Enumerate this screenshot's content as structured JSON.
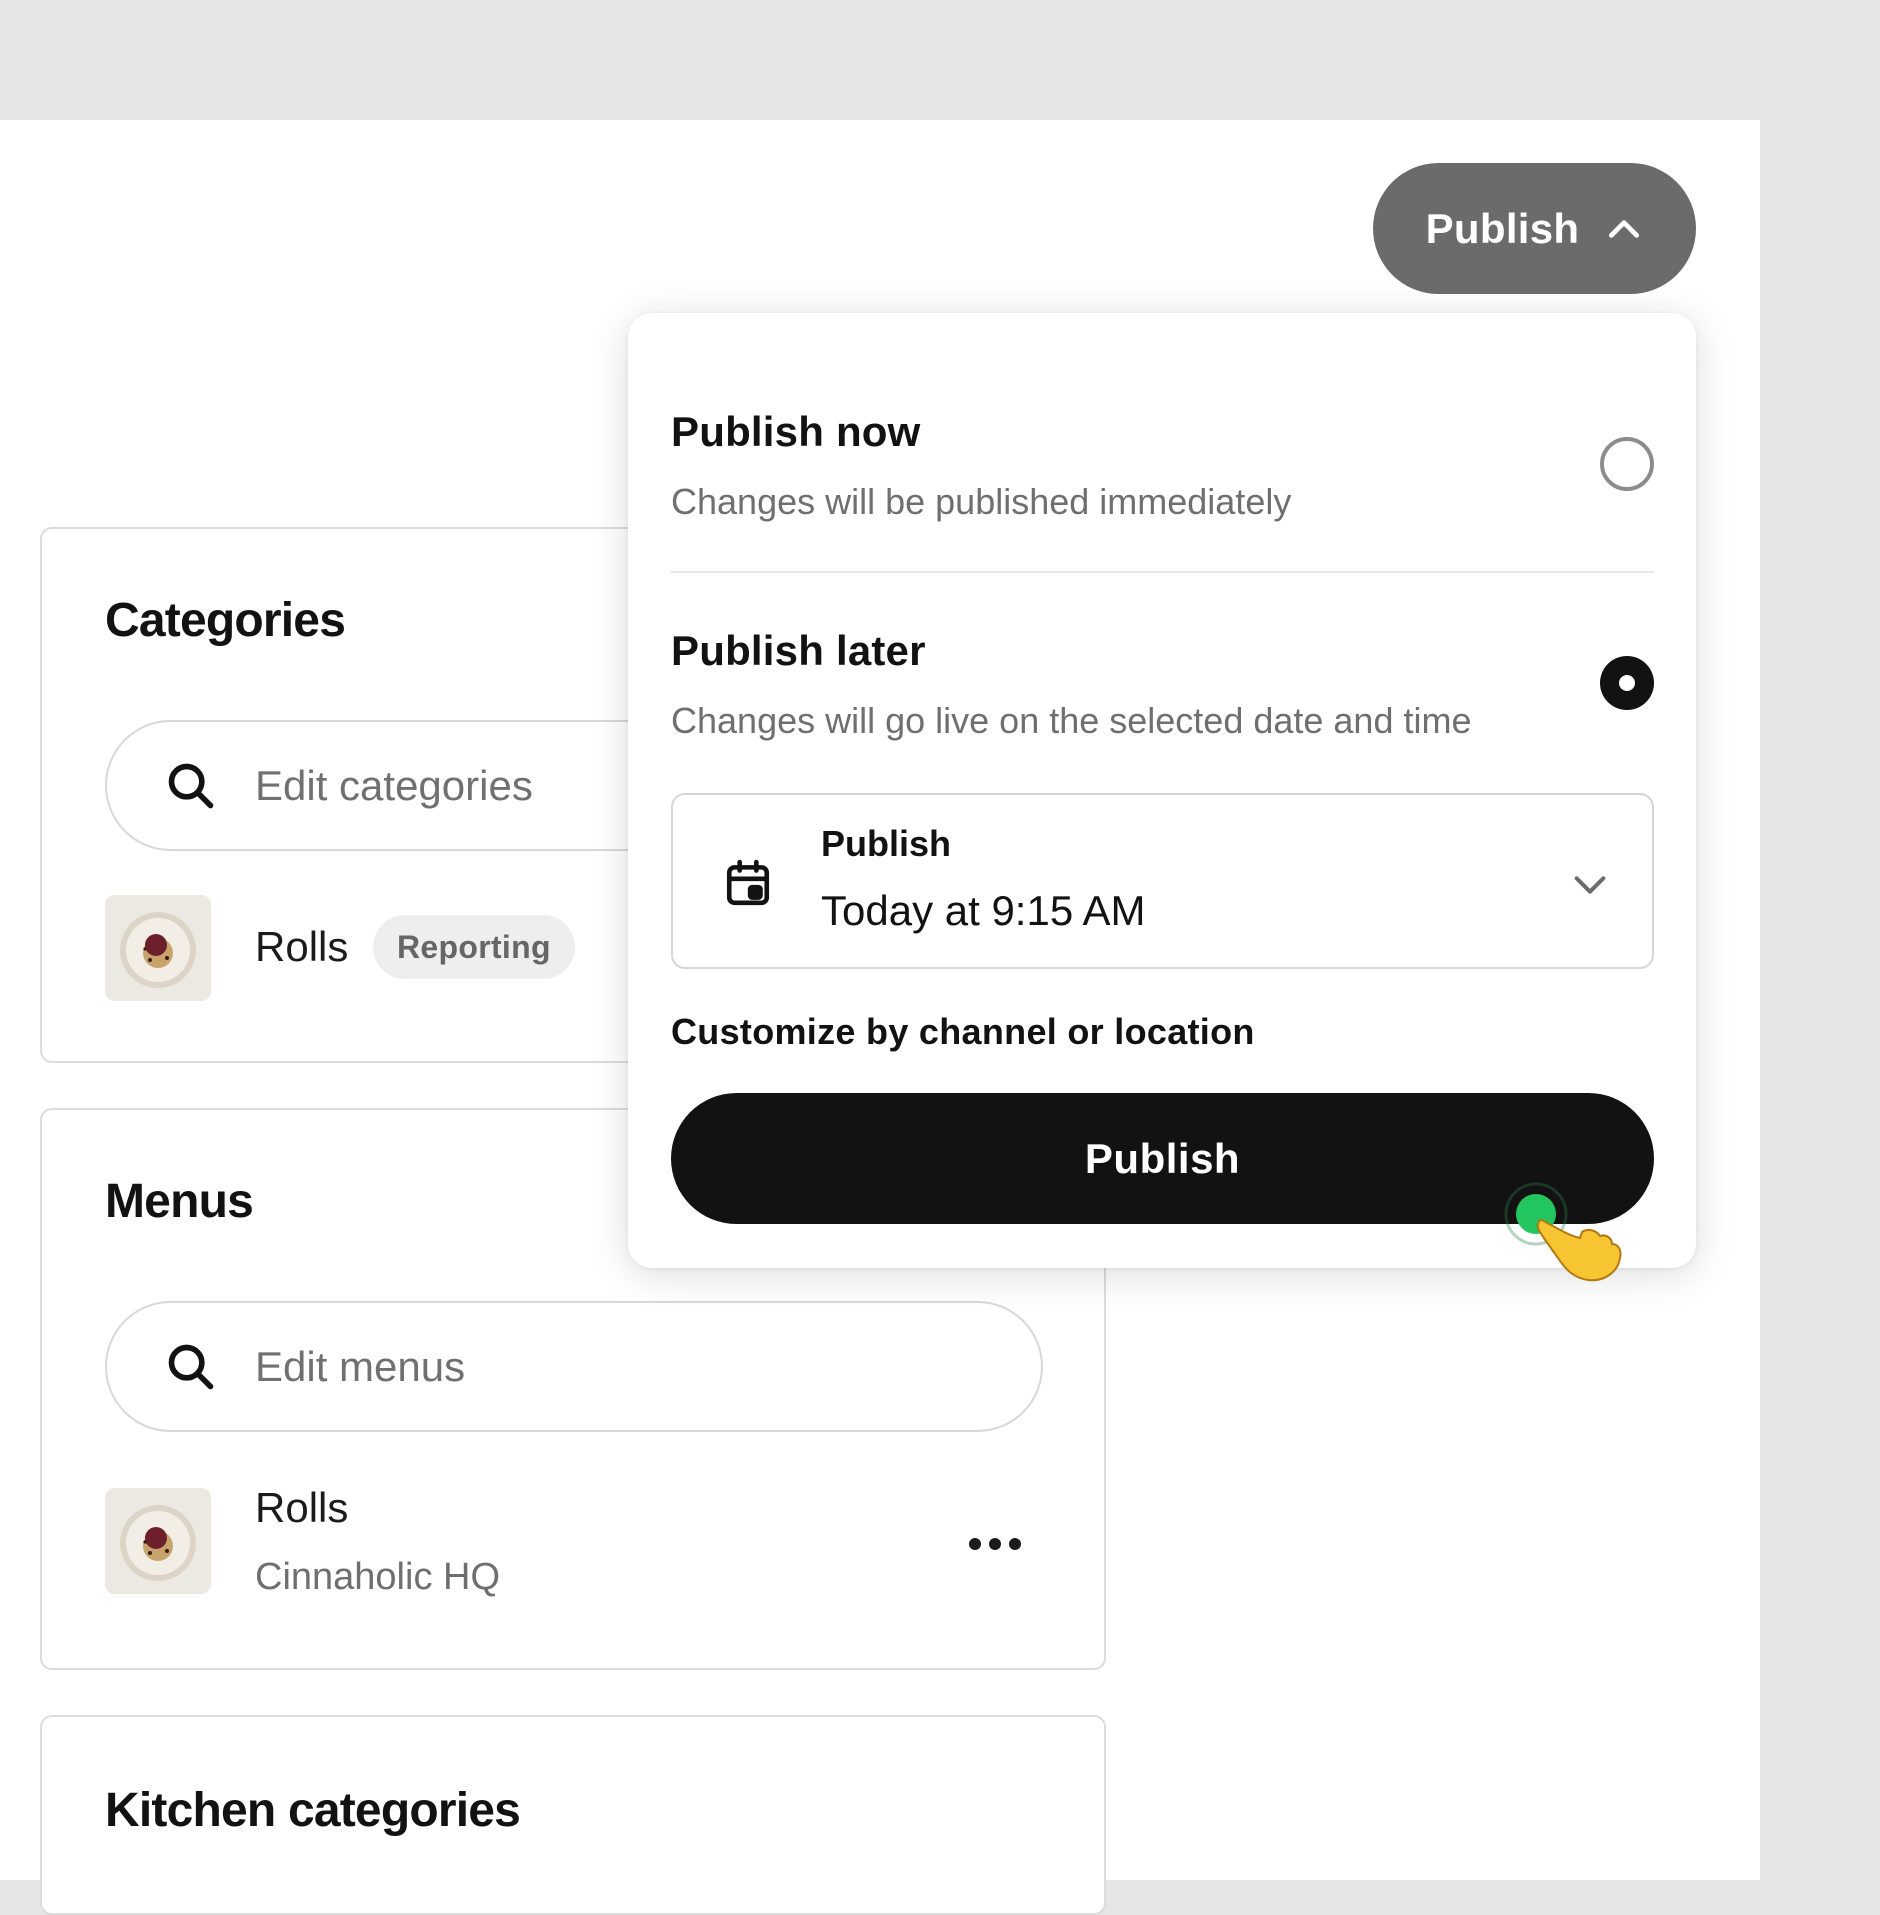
{
  "header": {
    "publish_label": "Publish",
    "publish_icon": "chevron-up-icon"
  },
  "categories": {
    "title": "Categories",
    "search_placeholder": "Edit categories",
    "items": [
      {
        "name": "Rolls",
        "badge": "Reporting"
      }
    ]
  },
  "menus": {
    "title": "Menus",
    "search_placeholder": "Edit menus",
    "items": [
      {
        "name": "Rolls",
        "location": "Cinnaholic HQ"
      }
    ]
  },
  "kitchen_categories": {
    "title": "Kitchen categories"
  },
  "publish_dropdown": {
    "options": [
      {
        "title": "Publish now",
        "description": "Changes will be published immediately",
        "selected": false
      },
      {
        "title": "Publish later",
        "description": "Changes will go live on the selected date and time",
        "selected": true
      }
    ],
    "schedule": {
      "label": "Publish",
      "value": "Today at 9:15 AM"
    },
    "customize_link": "Customize by channel or location",
    "confirm_label": "Publish"
  },
  "colors": {
    "background": "#e5e5e5",
    "primary_button": "#121212",
    "header_button": "#6b6b6b",
    "cursor_dot": "#22c55e"
  }
}
